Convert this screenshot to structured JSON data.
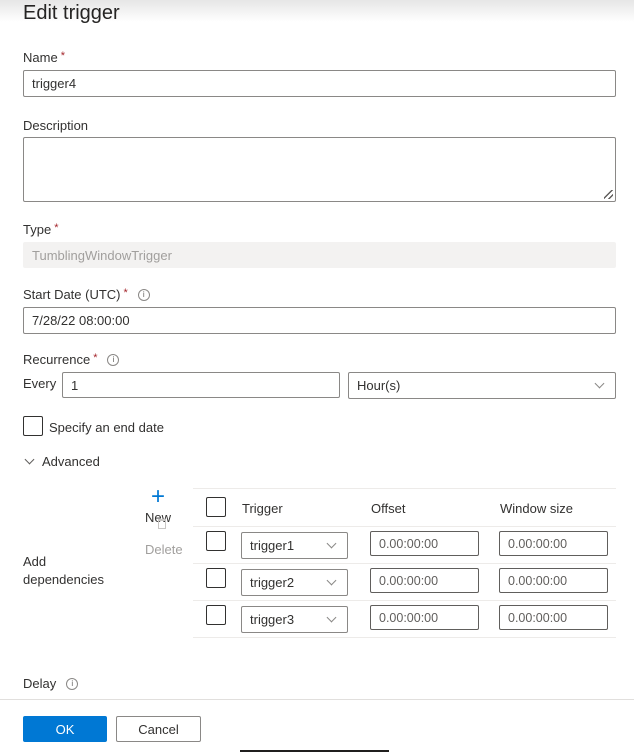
{
  "dialog": {
    "title": "Edit trigger",
    "required_marker": "*",
    "info_glyph": "i"
  },
  "name": {
    "label": "Name",
    "value": "trigger4"
  },
  "description": {
    "label": "Description",
    "value": ""
  },
  "type": {
    "label": "Type",
    "value": "TumblingWindowTrigger"
  },
  "start_date": {
    "label": "Start Date (UTC)",
    "value": "7/28/22 08:00:00"
  },
  "recurrence": {
    "label": "Recurrence",
    "every_label": "Every",
    "interval": "1",
    "unit": "Hour(s)"
  },
  "end_date": {
    "label": "Specify an end date",
    "checked": false
  },
  "advanced": {
    "label": "Advanced",
    "expanded": true
  },
  "dependencies": {
    "label_line1": "Add",
    "label_line2": "dependencies",
    "new_label": "New",
    "delete_label": "Delete",
    "columns": [
      "Trigger",
      "Offset",
      "Window size"
    ],
    "rows": [
      {
        "trigger": "trigger1",
        "offset": "0.00:00:00",
        "window_size": "0.00:00:00"
      },
      {
        "trigger": "trigger2",
        "offset": "0.00:00:00",
        "window_size": "0.00:00:00"
      },
      {
        "trigger": "trigger3",
        "offset": "0.00:00:00",
        "window_size": "0.00:00:00"
      }
    ]
  },
  "delay": {
    "label": "Delay"
  },
  "footer": {
    "ok_label": "OK",
    "cancel_label": "Cancel"
  },
  "colors": {
    "primary": "#0078d4",
    "required": "#a4262c"
  }
}
